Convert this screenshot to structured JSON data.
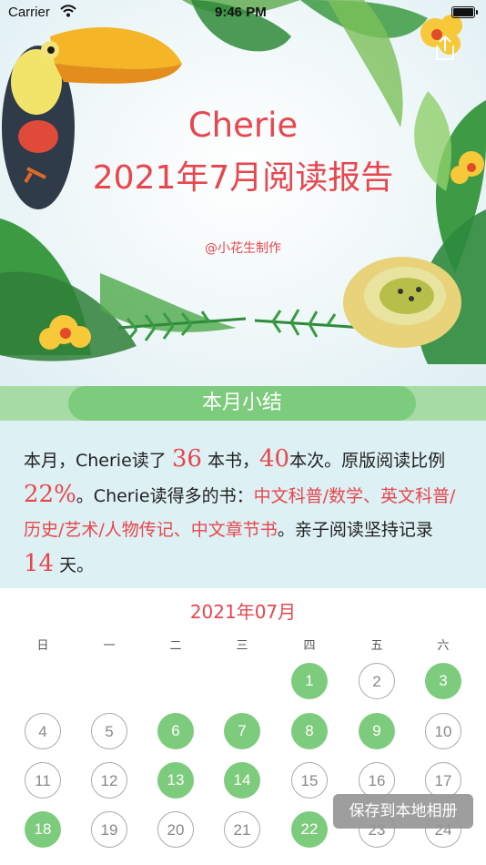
{
  "status_bar": {
    "carrier": "Carrier",
    "time": "9:46 PM"
  },
  "header": {
    "title_line1": "Cherie",
    "title_line2": "2021年7月阅读报告",
    "author": "@小花生制作"
  },
  "summary": {
    "heading": "本月小结",
    "p1": "本月，Cherie读了",
    "books": "36",
    "p2": "本书，",
    "times": "40",
    "p3": "本次。原版阅读比例",
    "ratio": "22%",
    "p4": "。Cherie读得多的书：",
    "categories": "中文科普/数学、英文科普/历史/艺术/人物传记、中文章节书",
    "p5": "。亲子阅读坚持记录",
    "days": "14",
    "p6": "天。"
  },
  "calendar": {
    "month": "2021年07月",
    "weekdays": [
      "日",
      "一",
      "二",
      "三",
      "四",
      "五",
      "六"
    ],
    "days": [
      {
        "d": "1",
        "read": true
      },
      {
        "d": "2",
        "read": false
      },
      {
        "d": "3",
        "read": true
      },
      {
        "d": "4",
        "read": false
      },
      {
        "d": "5",
        "read": false
      },
      {
        "d": "6",
        "read": true
      },
      {
        "d": "7",
        "read": true
      },
      {
        "d": "8",
        "read": true
      },
      {
        "d": "9",
        "read": true
      },
      {
        "d": "10",
        "read": false
      },
      {
        "d": "11",
        "read": false
      },
      {
        "d": "12",
        "read": false
      },
      {
        "d": "13",
        "read": true
      },
      {
        "d": "14",
        "read": true
      },
      {
        "d": "15",
        "read": false
      },
      {
        "d": "16",
        "read": false
      },
      {
        "d": "17",
        "read": false
      },
      {
        "d": "18",
        "read": true
      },
      {
        "d": "19",
        "read": false
      },
      {
        "d": "20",
        "read": false
      },
      {
        "d": "21",
        "read": false
      },
      {
        "d": "22",
        "read": true
      },
      {
        "d": "23",
        "read": false
      },
      {
        "d": "24",
        "read": false
      }
    ],
    "first_weekday": 4
  },
  "save_button": "保存到本地相册",
  "colors": {
    "accent_red": "#e8464d",
    "read_green": "#7dcb7c",
    "summary_bg": "#ddf0f3"
  }
}
